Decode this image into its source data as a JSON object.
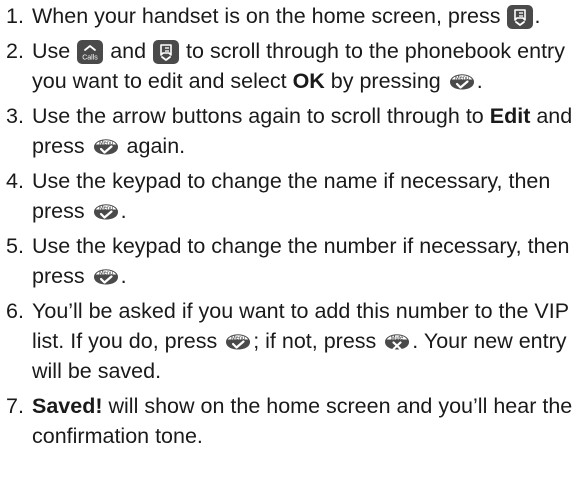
{
  "steps": [
    {
      "num": "1.",
      "t1": "When your handset is on the home screen, press",
      "t2": "."
    },
    {
      "num": "2.",
      "t1": "Use",
      "t2": "and",
      "t3": "to scroll through to the phonebook",
      "t4": "entry you want to edit and select",
      "b1": "OK",
      "t5": "by pressing",
      "t6": "."
    },
    {
      "num": "3.",
      "t1": "Use the arrow buttons again to scroll through to",
      "b1": "Edit",
      "t2": "and press",
      "t3": "again."
    },
    {
      "num": "4.",
      "t1": "Use the keypad to change the name if necessary,",
      "t2": "then press",
      "t3": "."
    },
    {
      "num": "5.",
      "t1": "Use the keypad to change the number if necessary,",
      "t2": "then press",
      "t3": "."
    },
    {
      "num": "6.",
      "t1": "You’ll be asked if you want to add this number to",
      "t2": "the VIP list. If you do, press",
      "t3": "; if not, press",
      "t4": ".",
      "t5": "Your new entry will be saved."
    },
    {
      "num": "7.",
      "b1": "Saved!",
      "t1": "will show on the home screen and you’ll hear",
      "t2": "the confirmation tone."
    }
  ],
  "keys": {
    "calls": {
      "name": "calls-key-icon",
      "label": "Calls"
    },
    "menu": {
      "name": "menu-ok-key-icon",
      "label": "Menu"
    },
    "mute": {
      "name": "mute-cancel-key-icon",
      "label": "Mute"
    },
    "phonebook": {
      "name": "phonebook-down-key-icon"
    }
  },
  "colors": {
    "key_fill": "#4a4a4a",
    "text": "#1a1a1a"
  }
}
